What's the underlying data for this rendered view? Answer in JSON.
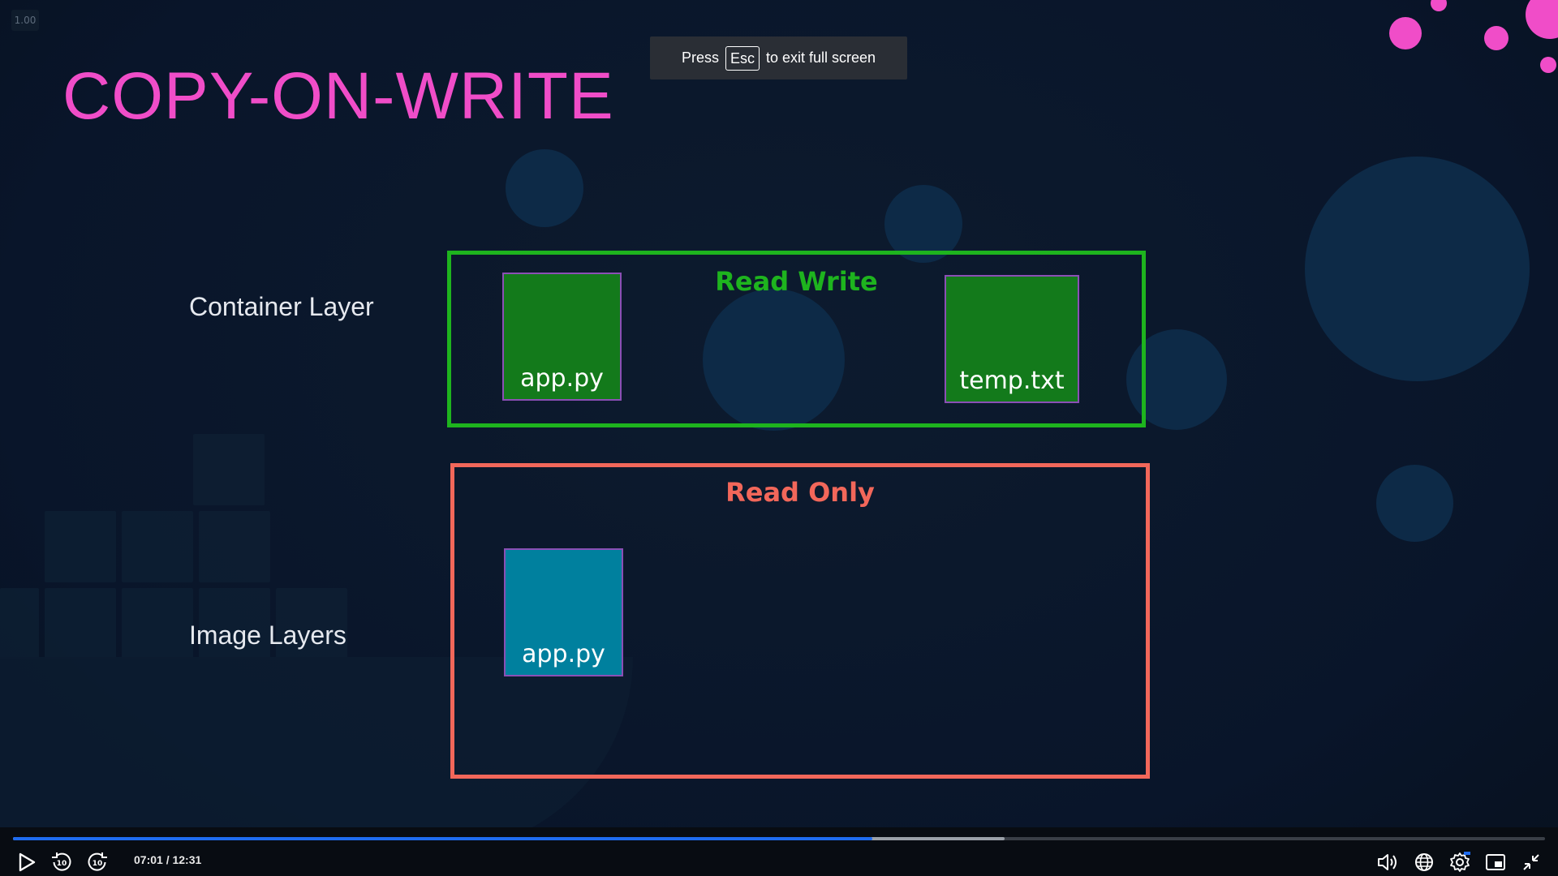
{
  "player": {
    "speed": "1.00",
    "time_text": "07:01 / 12:31",
    "progress": 0.561,
    "buffered": 0.647
  },
  "toast": {
    "prefix": "Press",
    "key": "Esc",
    "suffix": "to exit full screen"
  },
  "slide": {
    "title": "COPY-ON-WRITE",
    "container_label": "Container Layer",
    "image_label": "Image Layers",
    "read_write": {
      "title": "Read Write",
      "files": [
        "app.py",
        "temp.txt"
      ]
    },
    "read_only": {
      "title": "Read Only",
      "files": [
        "app.py"
      ]
    }
  },
  "colors": {
    "title": "#f04dc8",
    "read_write": "#1eb41e",
    "read_only": "#f2675a",
    "file_green": "#137a1b",
    "file_teal": "#00809e",
    "progress": "#1f6cf0"
  },
  "icons": [
    "play-icon",
    "rewind-10-icon",
    "forward-10-icon",
    "volume-icon",
    "globe-icon",
    "settings-icon",
    "pip-icon",
    "exit-fullscreen-icon"
  ]
}
